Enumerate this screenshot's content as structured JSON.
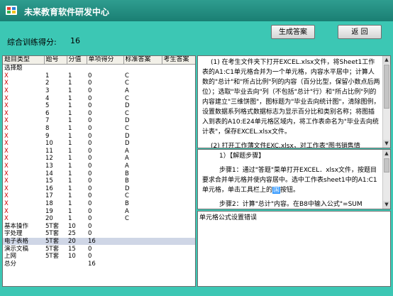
{
  "app": {
    "title": "未来教育软件研发中心",
    "score_label": "综合训练得分:",
    "score_value": "16",
    "buttons": {
      "generate": "生成答案",
      "back": "返  回"
    }
  },
  "table": {
    "headers": [
      "题目类型",
      "题号",
      "分值",
      "单项得分",
      "标准答案",
      "考生答案"
    ],
    "rows": [
      {
        "mark": "",
        "type": "选择题",
        "num": "",
        "score": "",
        "item": "",
        "std": "",
        "stu": ""
      },
      {
        "mark": "X",
        "type": "",
        "num": "1",
        "score": "1",
        "item": "0",
        "std": "C",
        "stu": ""
      },
      {
        "mark": "X",
        "type": "",
        "num": "2",
        "score": "1",
        "item": "0",
        "std": "C",
        "stu": ""
      },
      {
        "mark": "X",
        "type": "",
        "num": "3",
        "score": "1",
        "item": "0",
        "std": "A",
        "stu": ""
      },
      {
        "mark": "X",
        "type": "",
        "num": "4",
        "score": "1",
        "item": "0",
        "std": "C",
        "stu": ""
      },
      {
        "mark": "X",
        "type": "",
        "num": "5",
        "score": "1",
        "item": "0",
        "std": "D",
        "stu": ""
      },
      {
        "mark": "X",
        "type": "",
        "num": "6",
        "score": "1",
        "item": "0",
        "std": "C",
        "stu": ""
      },
      {
        "mark": "X",
        "type": "",
        "num": "7",
        "score": "1",
        "item": "0",
        "std": "D",
        "stu": ""
      },
      {
        "mark": "X",
        "type": "",
        "num": "8",
        "score": "1",
        "item": "0",
        "std": "C",
        "stu": ""
      },
      {
        "mark": "X",
        "type": "",
        "num": "9",
        "score": "1",
        "item": "0",
        "std": "D",
        "stu": ""
      },
      {
        "mark": "X",
        "type": "",
        "num": "10",
        "score": "1",
        "item": "0",
        "std": "D",
        "stu": ""
      },
      {
        "mark": "X",
        "type": "",
        "num": "11",
        "score": "1",
        "item": "0",
        "std": "A",
        "stu": ""
      },
      {
        "mark": "X",
        "type": "",
        "num": "12",
        "score": "1",
        "item": "0",
        "std": "A",
        "stu": ""
      },
      {
        "mark": "X",
        "type": "",
        "num": "13",
        "score": "1",
        "item": "0",
        "std": "A",
        "stu": ""
      },
      {
        "mark": "X",
        "type": "",
        "num": "14",
        "score": "1",
        "item": "0",
        "std": "B",
        "stu": ""
      },
      {
        "mark": "X",
        "type": "",
        "num": "15",
        "score": "1",
        "item": "0",
        "std": "B",
        "stu": ""
      },
      {
        "mark": "X",
        "type": "",
        "num": "16",
        "score": "1",
        "item": "0",
        "std": "D",
        "stu": ""
      },
      {
        "mark": "X",
        "type": "",
        "num": "17",
        "score": "1",
        "item": "0",
        "std": "C",
        "stu": ""
      },
      {
        "mark": "X",
        "type": "",
        "num": "18",
        "score": "1",
        "item": "0",
        "std": "B",
        "stu": ""
      },
      {
        "mark": "X",
        "type": "",
        "num": "19",
        "score": "1",
        "item": "0",
        "std": "A",
        "stu": ""
      },
      {
        "mark": "X",
        "type": "",
        "num": "20",
        "score": "1",
        "item": "0",
        "std": "C",
        "stu": ""
      },
      {
        "mark": "",
        "type": "基本操作",
        "num": "5T套",
        "score": "10",
        "item": "0",
        "std": "",
        "stu": ""
      },
      {
        "mark": "",
        "type": "字处理",
        "num": "5T套",
        "score": "25",
        "item": "0",
        "std": "",
        "stu": ""
      },
      {
        "mark": "",
        "type": "电子表格",
        "num": "5T套",
        "score": "20",
        "item": "16",
        "std": "",
        "stu": "",
        "selected": true
      },
      {
        "mark": "",
        "type": "演示文稿",
        "num": "5T套",
        "score": "15",
        "item": "0",
        "std": "",
        "stu": ""
      },
      {
        "mark": "",
        "type": "上网",
        "num": "5T套",
        "score": "10",
        "item": "0",
        "std": "",
        "stu": ""
      },
      {
        "mark": "",
        "type": "总分",
        "num": "",
        "score": "",
        "item": "16",
        "std": "",
        "stu": ""
      }
    ]
  },
  "pane_question": {
    "p1": "(1) 在考生文件夹下打开EXCEL.xlsx文件，将Sheet1工作表的A1:C1单元格合并为一个单元格，内容水平居中；计算人数的\"总计\"和\"所占比例\"列的内容（百分比型，保留小数点后两位）；选取\"毕业去向\"列（不包括\"总计\"行）和\"所占比例\"列的内容建立\"三维饼图\"，图标题为\"毕业去向统计图\"，清除图例，设置数据系列格式数据标志为显示百分比和类别名称；将图插入到表的A10:E24单元格区域内，将工作表命名为\"毕业去向统计表\"，保存EXCEL.xlsx文件。",
    "p2": "(2) 打开工作薄文件EXC.xlsx，对工作表\"图书销售情"
  },
  "pane_solution": {
    "heading": "1）【解题步骤】",
    "step1_a": "步骤1：通过\"答题\"菜单打开EXCEL．xlsx文件，按题目要求合并单元格并使内容居中。选中工作表sheet1中的A1:C1单元格，单击工具栏上的",
    "step1_icon": "国",
    "step1_b": "按钮。",
    "step2": "步骤2：计算\"总计\"内容。在B8中输入公式\"=SUM"
  },
  "pane_feedback": {
    "text": "单元格公式设置错误"
  },
  "colors": {
    "background": "#35c5b2",
    "titlebar": "#1a7f73",
    "mark": "#d00000",
    "selected_row": "#cfd6e6"
  }
}
